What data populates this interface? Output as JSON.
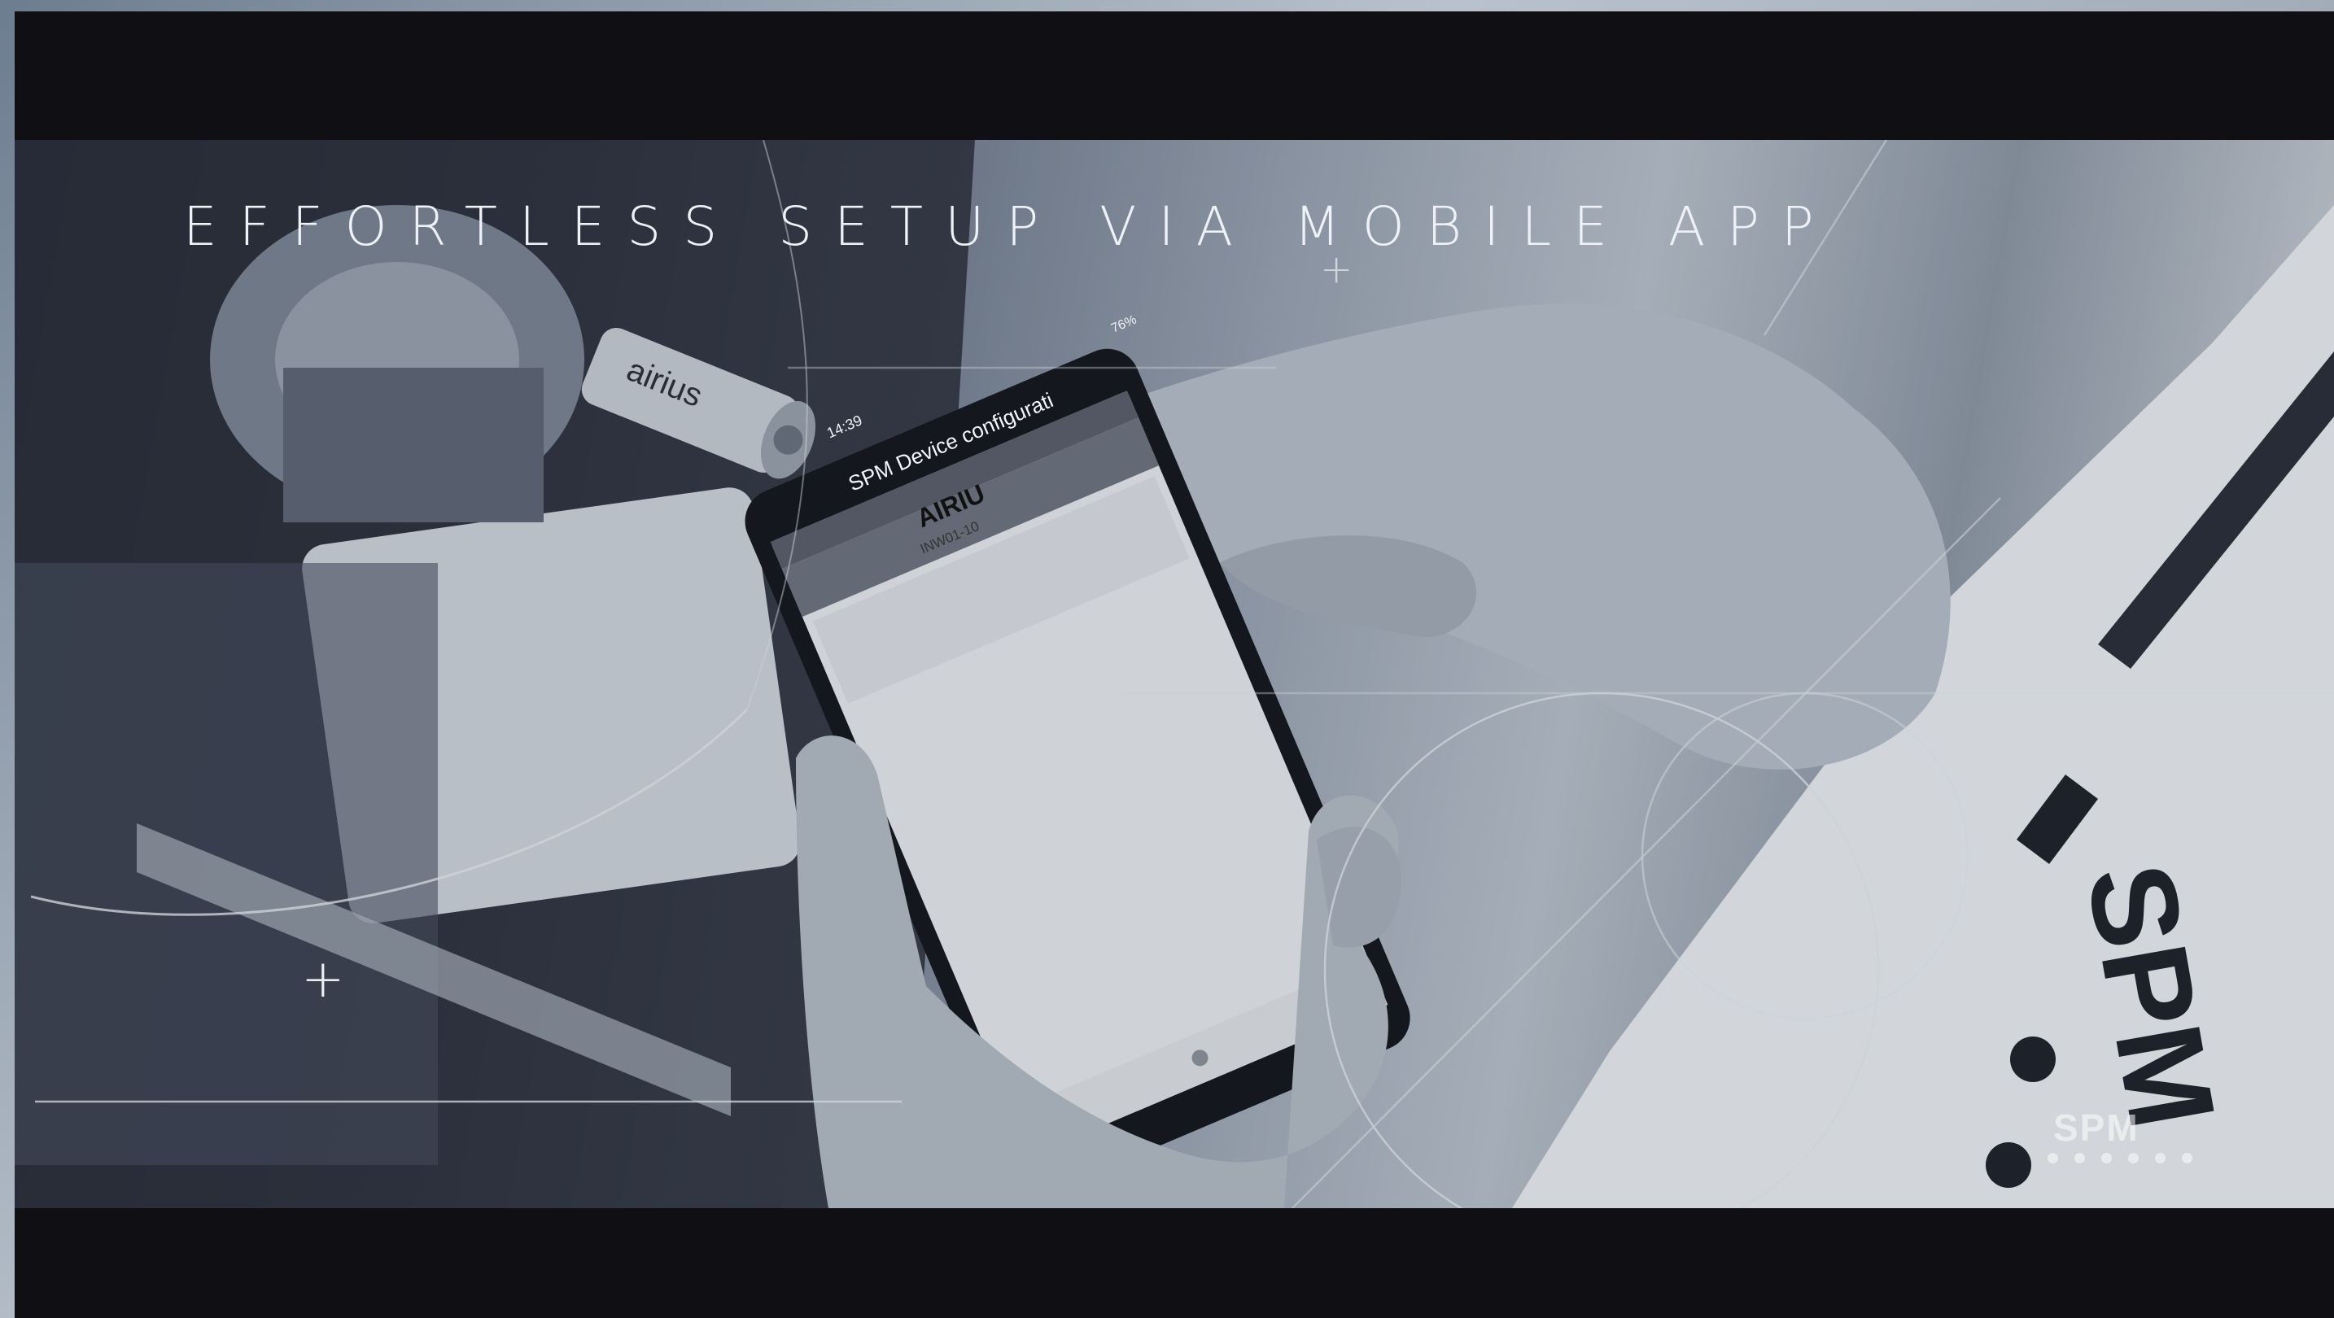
{
  "headline": "EFFORTLESS SETUP VIA MOBILE APP",
  "phone": {
    "status_time": "14:39",
    "status_battery": "76%",
    "app_title": "SPM Device configurati",
    "device_name": "AIRIU",
    "device_id": "INW01-10"
  },
  "sensor_label": "airius",
  "shirt_brand": "SPM",
  "watermark": "SPM",
  "colors": {
    "letterbox": "#0f0f14",
    "tint": "#9aa4b3",
    "text": "#eef1f5"
  }
}
